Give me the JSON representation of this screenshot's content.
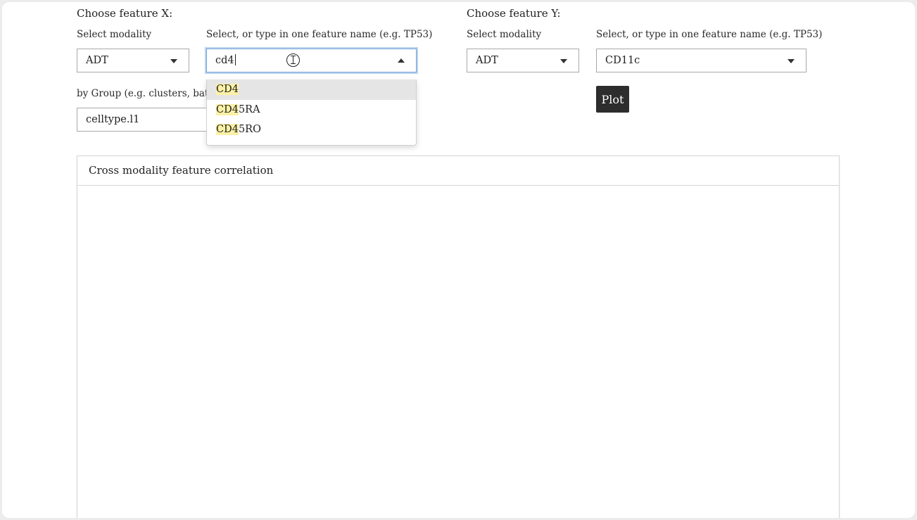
{
  "feature_x": {
    "heading": "Choose feature X:",
    "modality_label": "Select modality",
    "modality_value": "ADT",
    "feature_label": "Select, or type in one feature name (e.g. TP53)",
    "feature_input": "cd4",
    "options": [
      {
        "match": "CD4",
        "rest": ""
      },
      {
        "match": "CD4",
        "rest": "5RA"
      },
      {
        "match": "CD4",
        "rest": "5RO"
      }
    ],
    "group_label": "by Group (e.g. clusters, batch",
    "group_value": "celltype.l1"
  },
  "feature_y": {
    "heading": "Choose feature Y:",
    "modality_label": "Select modality",
    "modality_value": "ADT",
    "feature_label": "Select, or type in one feature name (e.g. TP53)",
    "feature_value": "CD11c"
  },
  "plot_button": "Plot",
  "panel": {
    "title": "Cross modality feature correlation"
  },
  "colors": {
    "match_highlight": "#fbf1a6",
    "focus_ring": "#b8d3ef",
    "button_bg": "#2d2d2d"
  }
}
